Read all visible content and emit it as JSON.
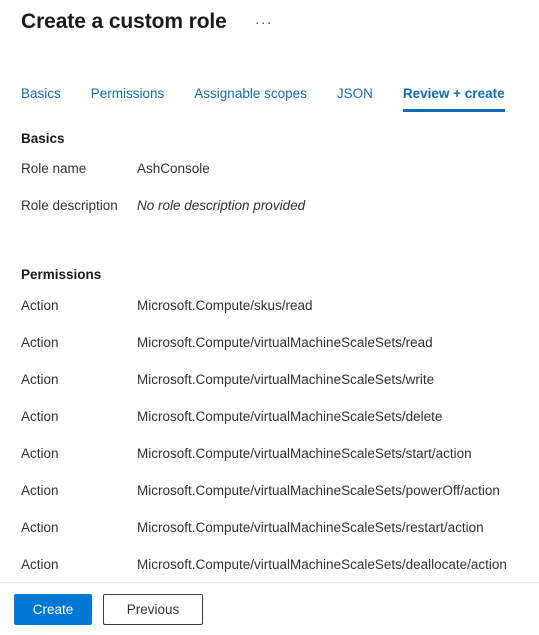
{
  "header": {
    "title": "Create a custom role",
    "more_menu": "···"
  },
  "tabs": [
    {
      "label": "Basics",
      "active": false
    },
    {
      "label": "Permissions",
      "active": false
    },
    {
      "label": "Assignable scopes",
      "active": false
    },
    {
      "label": "JSON",
      "active": false
    },
    {
      "label": "Review + create",
      "active": true
    }
  ],
  "basics": {
    "section_title": "Basics",
    "rows": [
      {
        "label": "Role name",
        "value": "AshConsole",
        "italic": false
      },
      {
        "label": "Role description",
        "value": "No role description provided",
        "italic": true
      }
    ]
  },
  "permissions": {
    "section_title": "Permissions",
    "rows": [
      {
        "label": "Action",
        "value": "Microsoft.Compute/skus/read"
      },
      {
        "label": "Action",
        "value": "Microsoft.Compute/virtualMachineScaleSets/read"
      },
      {
        "label": "Action",
        "value": "Microsoft.Compute/virtualMachineScaleSets/write"
      },
      {
        "label": "Action",
        "value": "Microsoft.Compute/virtualMachineScaleSets/delete"
      },
      {
        "label": "Action",
        "value": "Microsoft.Compute/virtualMachineScaleSets/start/action"
      },
      {
        "label": "Action",
        "value": "Microsoft.Compute/virtualMachineScaleSets/powerOff/action"
      },
      {
        "label": "Action",
        "value": "Microsoft.Compute/virtualMachineScaleSets/restart/action"
      },
      {
        "label": "Action",
        "value": "Microsoft.Compute/virtualMachineScaleSets/deallocate/action"
      }
    ]
  },
  "footer": {
    "create_label": "Create",
    "previous_label": "Previous"
  },
  "colors": {
    "accent": "#0078d4",
    "tab_link": "#0f6cbd",
    "text": "#323130",
    "heading": "#1b1a19",
    "divider": "#e1dfdd"
  }
}
